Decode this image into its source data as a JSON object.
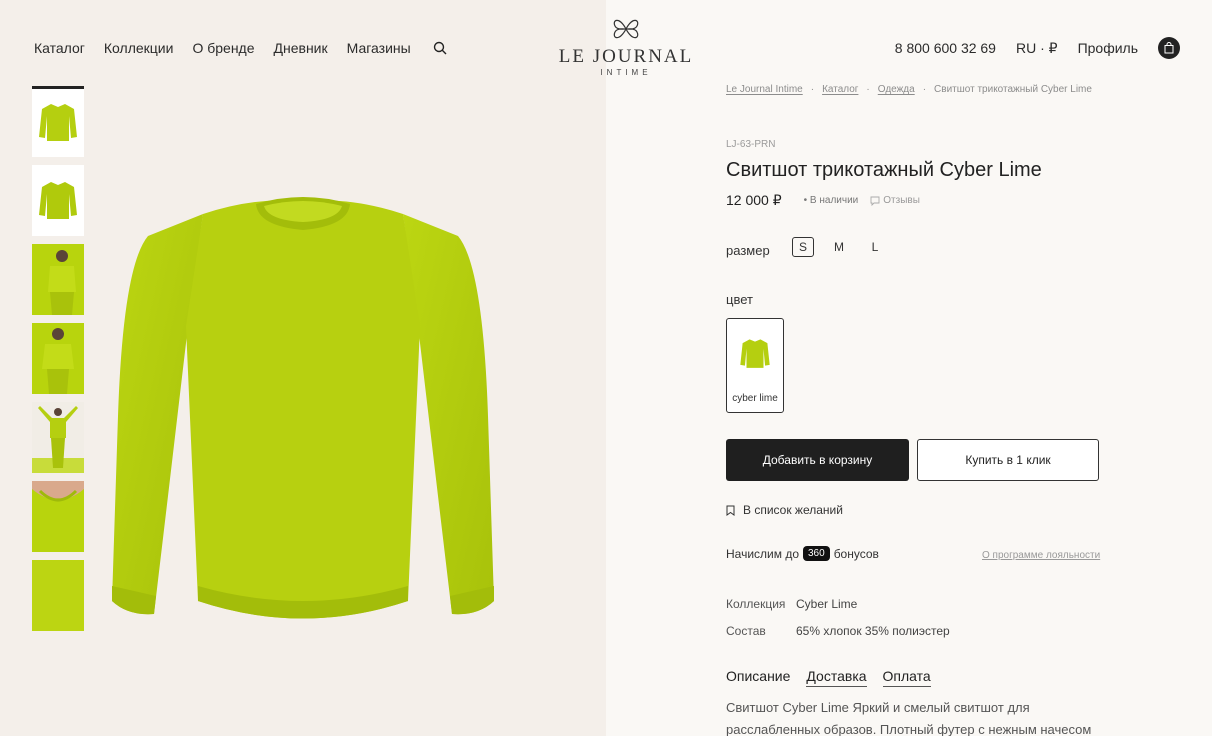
{
  "header": {
    "nav": [
      "Каталог",
      "Коллекции",
      "О бренде",
      "Дневник",
      "Магазины"
    ],
    "logo_main": "LE JOURNAL",
    "logo_sub": "INTIME",
    "phone": "8 800 600 32 69",
    "locale": "RU · ₽",
    "profile": "Профиль"
  },
  "breadcrumb": [
    "Le Journal Intime",
    "Каталог",
    "Одежда",
    "Свитшот трикотажный Cyber Lime"
  ],
  "product": {
    "sku": "LJ-63-PRN",
    "title": "Свитшот трикотажный Cyber Lime",
    "price": "12 000 ₽",
    "stock": "В наличии",
    "reviews": "Отзывы",
    "size_label": "размер",
    "sizes": [
      "S",
      "M",
      "L"
    ],
    "selected_size": "S",
    "color_label": "цвет",
    "color_name": "cyber lime",
    "add_to_cart": "Добавить в корзину",
    "buy_one_click": "Купить в 1 клик",
    "wishlist": "В список желаний",
    "bonus_prefix": "Начислим до",
    "bonus_value": "360",
    "bonus_suffix": "бонусов",
    "loyalty_link": "О программе лояльности",
    "specs": [
      {
        "key": "Коллекция",
        "value": "Cyber Lime"
      },
      {
        "key": "Состав",
        "value": "65% хлопок 35% полиэстер"
      }
    ],
    "tabs": [
      "Описание",
      "Доставка",
      "Оплата"
    ],
    "description": "Свитшот Cyber Lime Яркий и смелый свитшот для расслабленных образов. Плотный футер с нежным начесом"
  },
  "colors": {
    "lime": "#b5cf10",
    "lime_dark": "#9fba0a",
    "accent": "#1f1f1f",
    "page_bg": "#faf8f5",
    "gallery_bg": "#f4efea"
  },
  "icons": [
    "search-icon",
    "bag-icon",
    "bookmark-icon",
    "comment-icon",
    "logo-flower-icon"
  ]
}
